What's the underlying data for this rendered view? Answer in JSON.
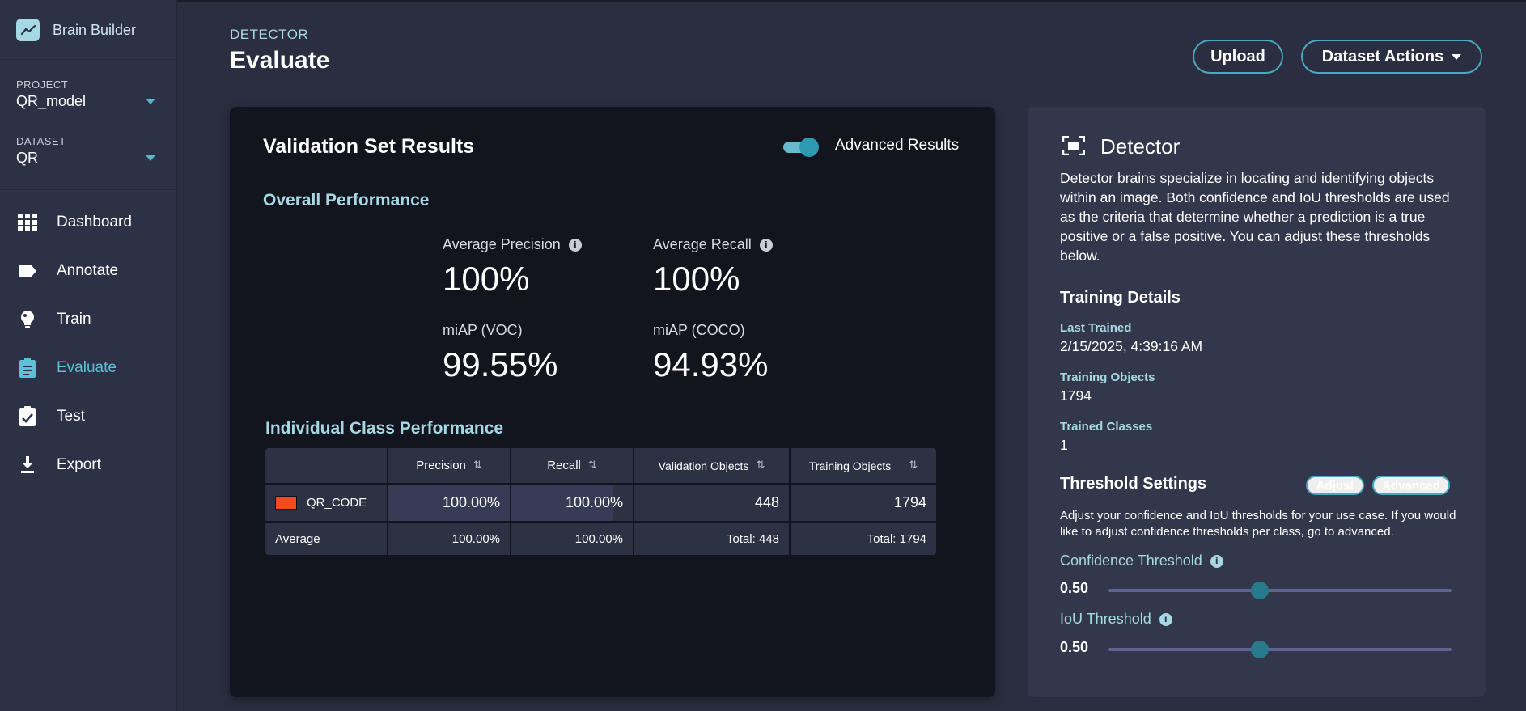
{
  "app": {
    "name": "Brain Builder"
  },
  "sidebar": {
    "project": {
      "label": "PROJECT",
      "value": "QR_model"
    },
    "dataset": {
      "label": "DATASET",
      "value": "QR"
    },
    "items": [
      {
        "label": "Dashboard",
        "icon": "dashboard-grid-icon"
      },
      {
        "label": "Annotate",
        "icon": "tag-icon"
      },
      {
        "label": "Train",
        "icon": "lightbulb-icon"
      },
      {
        "label": "Evaluate",
        "icon": "clipboard-icon",
        "active": true
      },
      {
        "label": "Test",
        "icon": "clipboard-check-icon"
      },
      {
        "label": "Export",
        "icon": "download-icon"
      }
    ]
  },
  "header": {
    "eyebrow": "DETECTOR",
    "title": "Evaluate",
    "upload_label": "Upload",
    "dataset_actions_label": "Dataset Actions"
  },
  "results": {
    "title": "Validation Set Results",
    "advanced_toggle": {
      "label": "Advanced Results",
      "on": true
    },
    "overall_title": "Overall Performance",
    "metrics": {
      "avg_precision": {
        "label": "Average Precision",
        "value": "100%"
      },
      "avg_recall": {
        "label": "Average Recall",
        "value": "100%"
      },
      "miap_voc": {
        "label": "miAP (VOC)",
        "value": "99.55%"
      },
      "miap_coco": {
        "label": "miAP (COCO)",
        "value": "94.93%"
      }
    },
    "class_title": "Individual Class Performance",
    "table": {
      "headers": [
        "",
        "Precision",
        "Recall",
        "Validation Objects",
        "Training Objects"
      ],
      "rows": [
        {
          "class": "QR_CODE",
          "color": "#f14b23",
          "precision": "100.00%",
          "recall": "100.00%",
          "validation": "448",
          "training": "1794"
        }
      ],
      "average": {
        "label": "Average",
        "precision": "100.00%",
        "recall": "100.00%",
        "validation": "Total: 448",
        "training": "Total: 1794"
      }
    }
  },
  "detector": {
    "title": "Detector",
    "description": "Detector brains specialize in locating and identifying objects within an image. Both confidence and IoU thresholds are used as the criteria that determine whether a prediction is a true positive or a false positive. You can adjust these thresholds below.",
    "training_details_title": "Training Details",
    "last_trained": {
      "label": "Last Trained",
      "value": "2/15/2025, 4:39:16 AM"
    },
    "training_objects": {
      "label": "Training Objects",
      "value": "1794"
    },
    "trained_classes": {
      "label": "Trained Classes",
      "value": "1"
    },
    "threshold_title": "Threshold Settings",
    "adjust_label": "Adjust",
    "advanced_label": "Advanced",
    "threshold_description": "Adjust your confidence and IoU thresholds for your use case. If you would like to adjust confidence thresholds per class, go to advanced.",
    "confidence": {
      "label": "Confidence Threshold",
      "value": "0.50",
      "fraction": 0.44
    },
    "iou": {
      "label": "IoU Threshold",
      "value": "0.50",
      "fraction": 0.44
    }
  },
  "colors": {
    "accent": "#4aa8bf",
    "accent_text": "#a6d8e4",
    "active_nav": "#5cc0d6"
  }
}
